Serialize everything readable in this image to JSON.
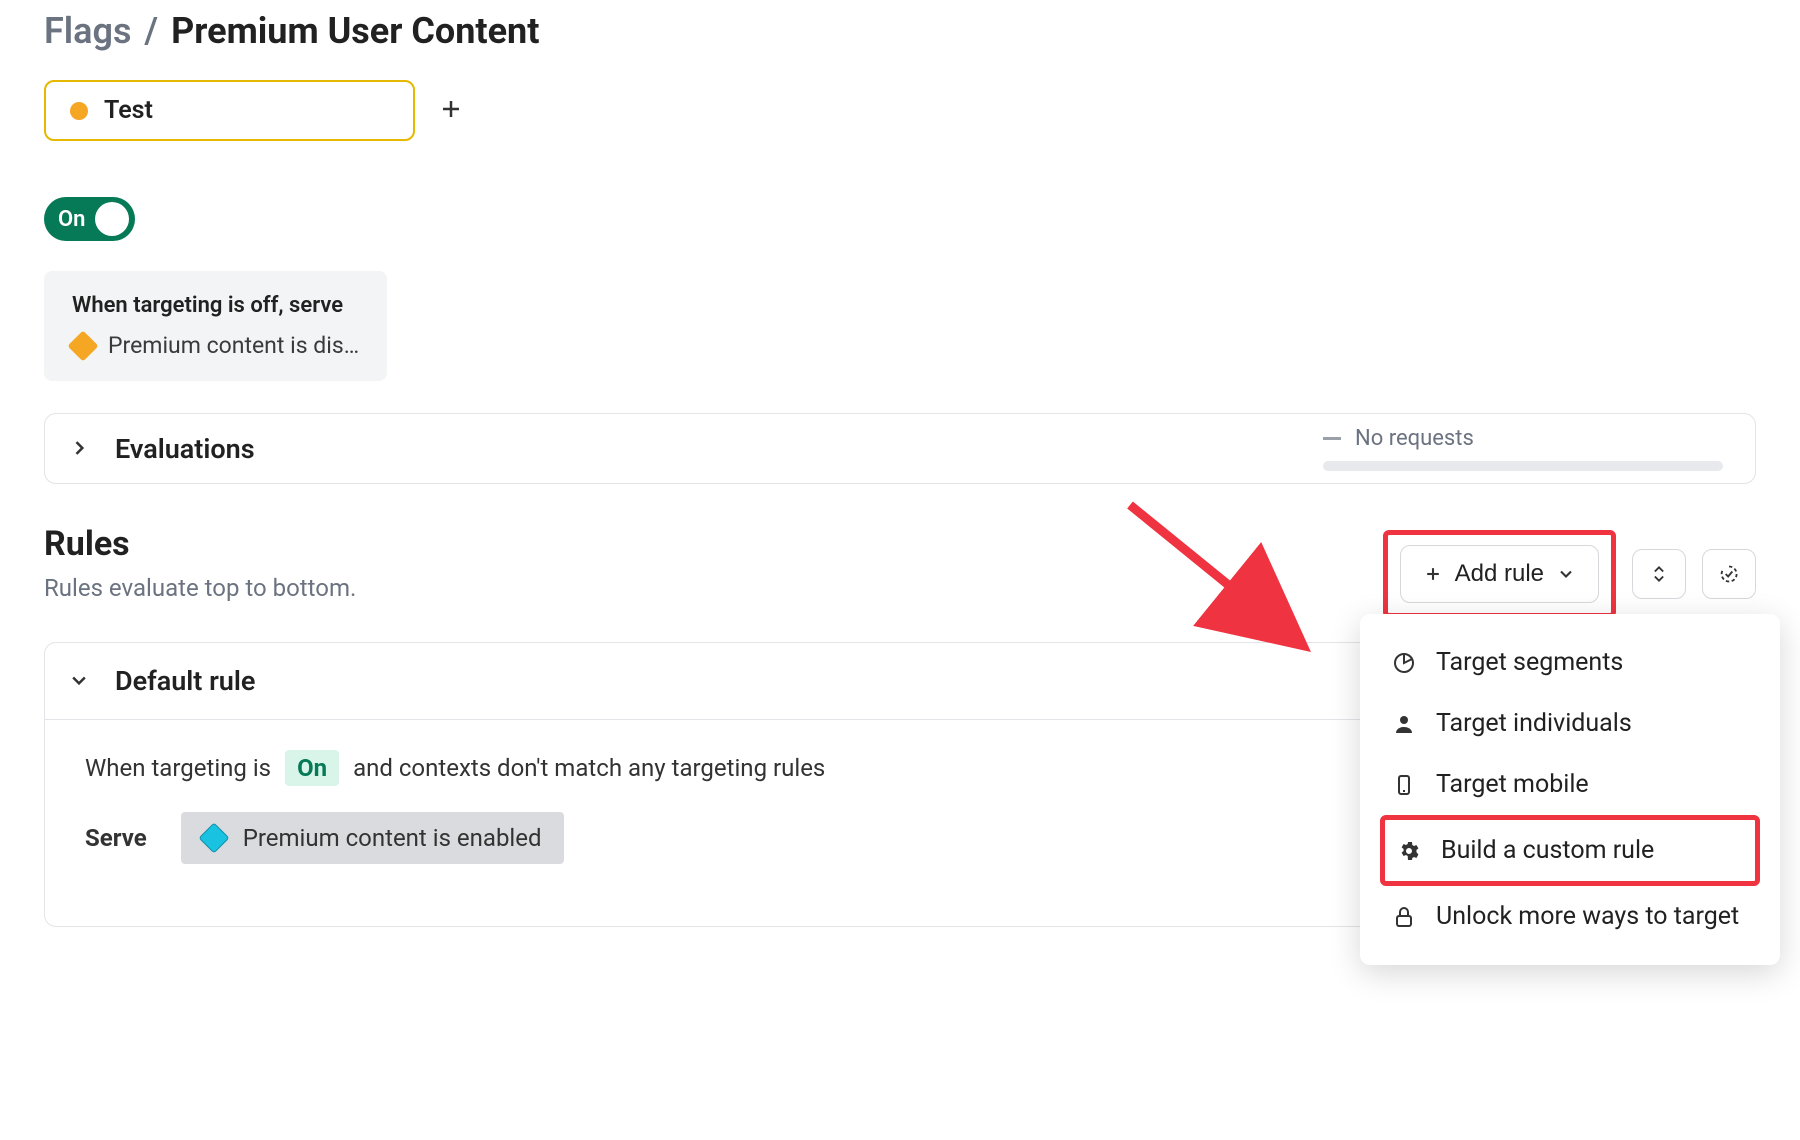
{
  "breadcrumb": {
    "root": "Flags",
    "sep": "/",
    "current": "Premium User Content"
  },
  "environment": {
    "label": "Test"
  },
  "toggle": {
    "label": "On"
  },
  "off_serve": {
    "title": "When targeting is off, serve",
    "variation": "Premium content is dis…"
  },
  "evaluations": {
    "title": "Evaluations",
    "no_requests": "No requests"
  },
  "rules": {
    "heading": "Rules",
    "subheading": "Rules evaluate top to bottom.",
    "add_rule_label": "Add rule"
  },
  "default_rule": {
    "title": "Default rule",
    "sentence_a": "When targeting is",
    "on_chip": "On",
    "sentence_b": "and contexts don't match any targeting rules",
    "serve_label": "Serve",
    "variation": "Premium content is enabled"
  },
  "add_rule_menu": {
    "items": [
      {
        "icon": "target-segments-icon",
        "label": "Target segments"
      },
      {
        "icon": "target-individuals-icon",
        "label": "Target individuals"
      },
      {
        "icon": "target-mobile-icon",
        "label": "Target mobile"
      },
      {
        "icon": "build-custom-rule-icon",
        "label": "Build a custom rule"
      },
      {
        "icon": "unlock-icon",
        "label": "Unlock more ways to target"
      }
    ]
  }
}
